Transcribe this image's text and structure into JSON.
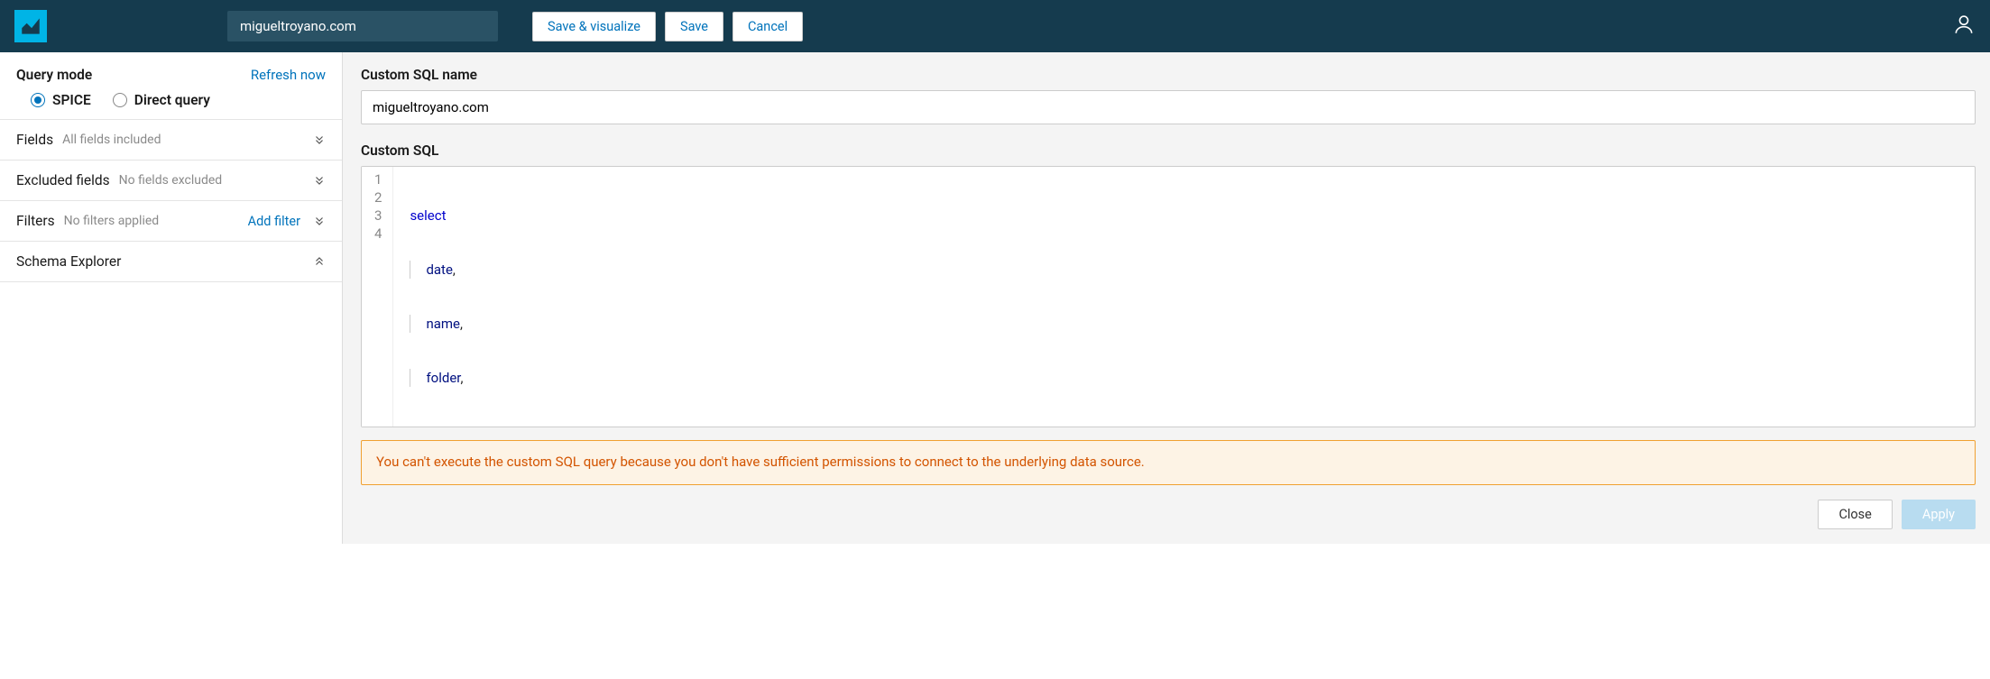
{
  "header": {
    "dataset_name": "migueltroyano.com",
    "save_visualize_label": "Save & visualize",
    "save_label": "Save",
    "cancel_label": "Cancel"
  },
  "sidebar": {
    "query_mode": {
      "title": "Query mode",
      "refresh_label": "Refresh now",
      "options": [
        {
          "label": "SPICE",
          "checked": true
        },
        {
          "label": "Direct query",
          "checked": false
        }
      ]
    },
    "panels": {
      "fields": {
        "title": "Fields",
        "subtitle": "All fields included"
      },
      "excluded": {
        "title": "Excluded fields",
        "subtitle": "No fields excluded"
      },
      "filters": {
        "title": "Filters",
        "subtitle": "No filters applied",
        "add_label": "Add filter"
      },
      "schema": {
        "title": "Schema Explorer"
      }
    }
  },
  "main": {
    "custom_sql_name_label": "Custom SQL name",
    "custom_sql_name_value": "migueltroyano.com",
    "custom_sql_label": "Custom SQL",
    "sql_lines": [
      {
        "n": "1",
        "indent": false,
        "keyword": "select",
        "rest": ""
      },
      {
        "n": "2",
        "indent": true,
        "id": "date",
        "rest": ","
      },
      {
        "n": "3",
        "indent": true,
        "id": "name",
        "rest": ","
      },
      {
        "n": "4",
        "indent": true,
        "id": "folder",
        "rest": ","
      }
    ],
    "alert_text": "You can't execute the custom SQL query because you don't have sufficient permissions to connect to the underlying data source.",
    "close_label": "Close",
    "apply_label": "Apply"
  }
}
